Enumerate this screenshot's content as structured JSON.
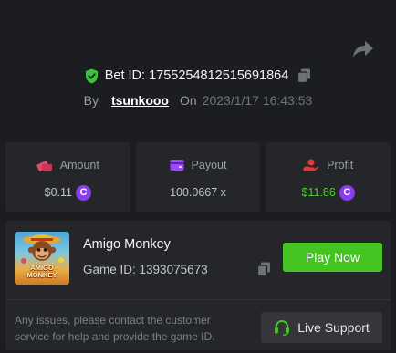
{
  "bet": {
    "label": "Bet ID:",
    "id": "1755254812515691864",
    "by_label": "By",
    "user": "tsunkooo",
    "on_label": "On",
    "time": "2023/1/17 16:43:53"
  },
  "stats": {
    "amount": {
      "label": "Amount",
      "value": "$0.11"
    },
    "payout": {
      "label": "Payout",
      "value": "100.0667 x"
    },
    "profit": {
      "label": "Profit",
      "value": "$11.86"
    }
  },
  "game": {
    "name": "Amigo Monkey",
    "id_label": "Game ID:",
    "id": "1393075673",
    "thumbnail_logo": "AMIGO MONKEY",
    "play_label": "Play Now",
    "notice": "Any issues, please contact the customer service for help and provide the game ID.",
    "support_label": "Live Support"
  },
  "colors": {
    "background": "#1b1d20",
    "card": "#24262a",
    "accent_green": "#44c321",
    "profit_green": "#4fd12a",
    "coin_purple": "#8b3cf0",
    "amount_icon": "#e2486a",
    "payout_icon": "#9a4cf2",
    "profit_icon": "#e23a3a",
    "shield_green": "#3bc33b"
  },
  "icons": {
    "share": "share-icon",
    "shield": "shield-check-icon",
    "copy": "copy-icon",
    "amount": "amount-icon",
    "payout": "wallet-icon",
    "profit": "profit-icon",
    "coin": "coin-icon",
    "headset": "headset-icon"
  }
}
